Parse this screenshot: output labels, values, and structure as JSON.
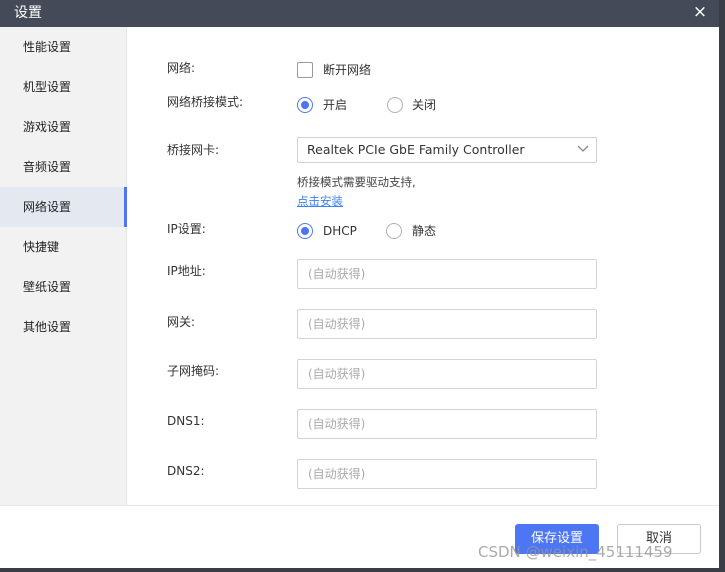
{
  "window": {
    "title": "设置",
    "close_icon": "×"
  },
  "sidebar": {
    "items": [
      {
        "label": "性能设置"
      },
      {
        "label": "机型设置"
      },
      {
        "label": "游戏设置"
      },
      {
        "label": "音频设置"
      },
      {
        "label": "网络设置",
        "active": true
      },
      {
        "label": "快捷键"
      },
      {
        "label": "壁纸设置"
      },
      {
        "label": "其他设置"
      }
    ]
  },
  "network": {
    "network_label": "网络:",
    "disconnect_label": "断开网络",
    "disconnect_checked": false,
    "bridge_mode_label": "网络桥接模式:",
    "bridge_on": "开启",
    "bridge_off": "关闭",
    "bridge_selected": "开启",
    "bridge_nic_label": "桥接网卡:",
    "bridge_nic_value": "Realtek PCIe GbE Family Controller",
    "driver_note": "桥接模式需要驱动支持,",
    "install_link": "点击安装",
    "ip_setting_label": "IP设置:",
    "ip_dhcp": "DHCP",
    "ip_static": "静态",
    "ip_selected": "DHCP",
    "ip_address_label": "IP地址:",
    "gateway_label": "网关:",
    "subnet_label": "子网掩码:",
    "dns1_label": "DNS1:",
    "dns2_label": "DNS2:",
    "auto_placeholder": "(自动获得)"
  },
  "footer": {
    "save_label": "保存设置",
    "cancel_label": "取消"
  },
  "watermark": "CSDN @weixin_45111459",
  "colors": {
    "accent": "#4d76f5",
    "titlebar": "#444a57",
    "sidebar_bg": "#f2f2f2",
    "link": "#3b82f6"
  }
}
